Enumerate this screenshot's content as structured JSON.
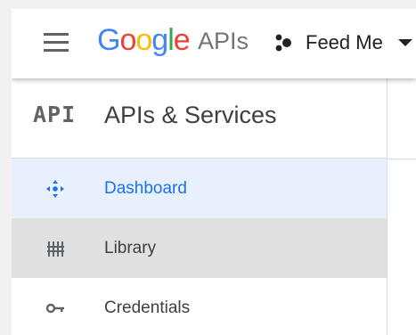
{
  "header": {
    "logo_letters": [
      "G",
      "o",
      "o",
      "g",
      "l",
      "e"
    ],
    "logo_suffix": "APIs",
    "project_name": "Feed Me",
    "menu_icon": "hamburger-menu-icon",
    "project_icon": "project-dots-icon",
    "caret_icon": "caret-down-icon"
  },
  "sidebar": {
    "logo_text": "API",
    "title": "APIs & Services",
    "items": [
      {
        "label": "Dashboard",
        "icon": "dashboard-icon",
        "state": "active"
      },
      {
        "label": "Library",
        "icon": "library-icon",
        "state": "hover"
      },
      {
        "label": "Credentials",
        "icon": "key-icon",
        "state": "normal"
      }
    ]
  },
  "colors": {
    "google_blue": "#4285F4",
    "google_red": "#EA4335",
    "google_yellow": "#FBBC05",
    "google_green": "#34A853",
    "active_text": "#1a73e8",
    "active_bg": "#e8f0fe",
    "hover_bg": "#e0e0e0"
  }
}
